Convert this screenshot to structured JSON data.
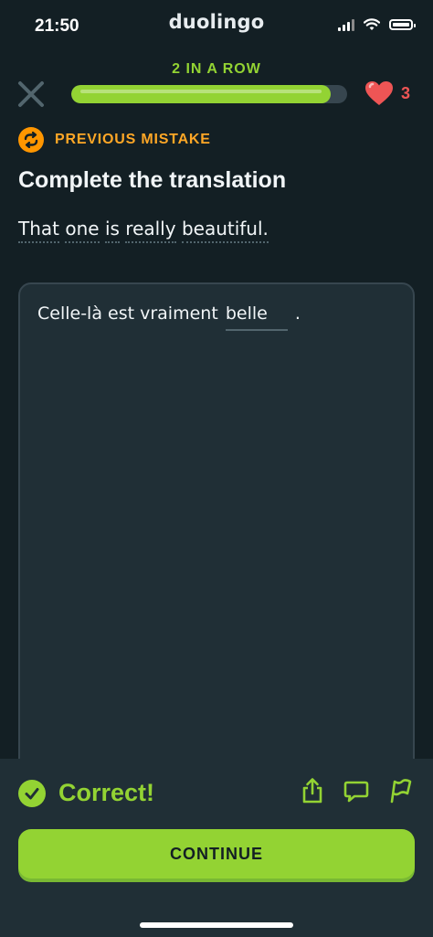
{
  "status_bar": {
    "time": "21:50",
    "brand": "duolingo"
  },
  "lesson": {
    "streak_label": "2 IN A ROW",
    "progress_fraction": 0.94,
    "hearts": "3"
  },
  "exercise": {
    "badge_label": "PREVIOUS MISTAKE",
    "title": "Complete the translation",
    "prompt_words": [
      "That",
      "one",
      "is",
      "really",
      "beautiful."
    ],
    "answer_prefix": "Celle-là est vraiment",
    "answer_filled": "belle",
    "answer_suffix": "."
  },
  "feedback": {
    "result": "Correct!",
    "continue_label": "CONTINUE"
  },
  "colors": {
    "background": "#131f24",
    "accent_green": "#93d333",
    "warning_orange": "#ff9600",
    "heart_red": "#ee5555"
  }
}
